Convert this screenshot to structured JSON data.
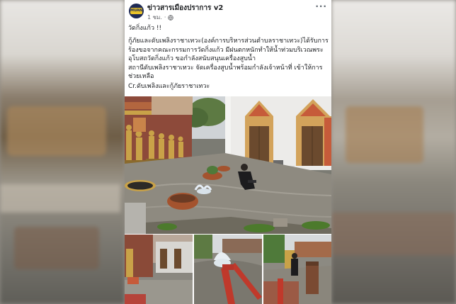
{
  "post": {
    "page_name": "ข่าวสารเมืองปราการ v2",
    "time": "1 ชม.",
    "more_label": "···",
    "avatar_logo_text": "MUANG",
    "paragraphs": [
      "วัดกิ่งแก้ว !!",
      "กู้ภัยและดับเพลิงราชาเทวะ(องค์การบริหารส่วนตำบลราชาเทวะ)ได้รับการร้องขอจากคณะกรรมการวัดกิ่งแก้ว มีฝนตกหนักทำให้น้ำท่วมบริเวณพระอุโบสถวัดกิ่งแก้ว ขอกำลังสนับสนุนเครื่องสูบน้ำ",
      "สถานีดับเพลิงราชาเทวะ จัดเครื่องสูบน้ำพร้อมกำลังเจ้าหน้าที่ เข้าให้การช่วยเหลือ",
      "Cr.ดับเพลิงและกู้ภัยราชาเทวะ"
    ]
  },
  "colors": {
    "avatar_bg": "#1e2a55",
    "avatar_logo": "#e9c32a",
    "temple_gold": "#c9a248",
    "flood_water": "#8e8a80"
  }
}
